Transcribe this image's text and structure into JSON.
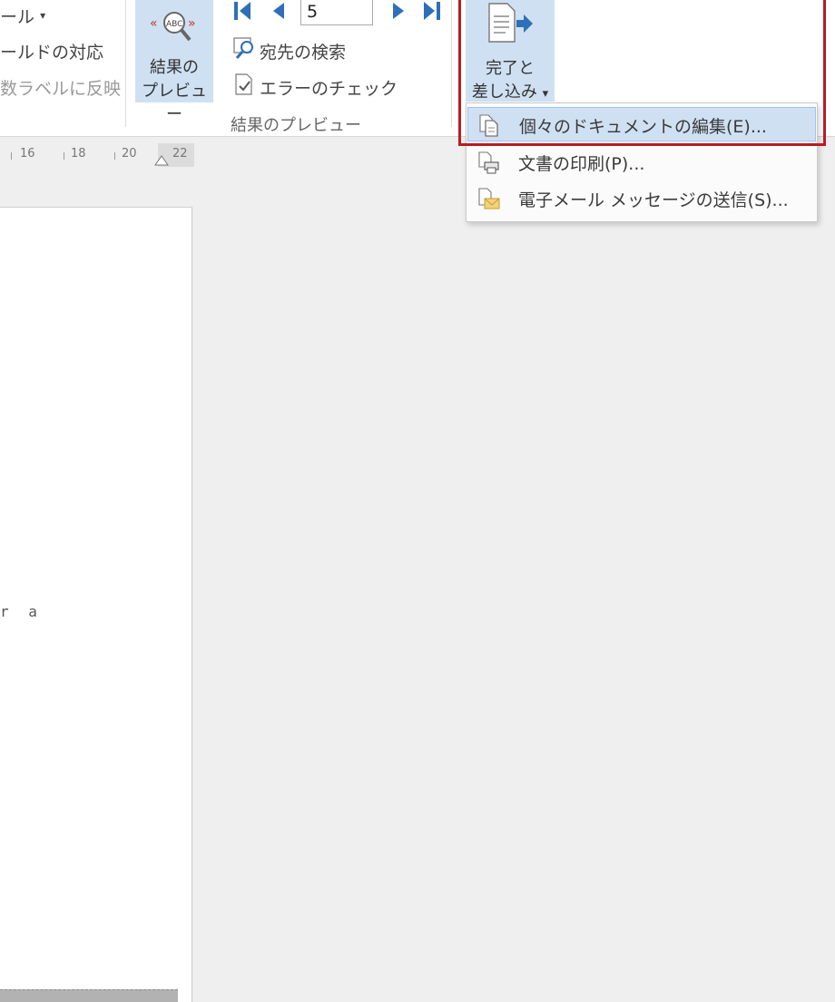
{
  "ribbon": {
    "left_group": {
      "item1": "ール",
      "item2": "ールドの対応",
      "item3": "数ラベルに反映"
    },
    "preview": {
      "line1": "結果の",
      "line2": "プレビュー"
    },
    "record": {
      "value": "5"
    },
    "find_recipient": "宛先の検索",
    "check_errors": "エラーのチェック",
    "group_label": "結果のプレビュー",
    "finish": {
      "line1": "完了と",
      "line2": "差し込み",
      "arrow": "▾"
    }
  },
  "ruler": {
    "labels": [
      "16",
      "18",
      "20",
      "22"
    ]
  },
  "document": {
    "fragment": "r a"
  },
  "menu": {
    "items": [
      {
        "label": "個々のドキュメントの編集(E)...",
        "icon": "edit-documents-icon",
        "active": true
      },
      {
        "label": "文書の印刷(P)...",
        "icon": "print-documents-icon",
        "active": false
      },
      {
        "label": "電子メール メッセージの送信(S)...",
        "icon": "send-email-icon",
        "active": false
      }
    ]
  },
  "colors": {
    "accent": "#cfe0f3",
    "highlight_border": "#b81c24",
    "nav_blue": "#2e6fb8"
  }
}
